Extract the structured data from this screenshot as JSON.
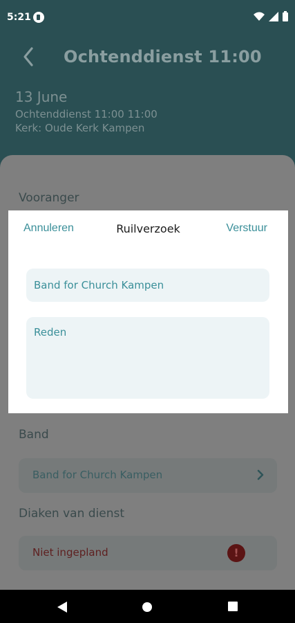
{
  "status_bar": {
    "time": "5:21"
  },
  "header": {
    "title": "Ochtenddienst 11:00",
    "date": "13 June",
    "service_line": "Ochtenddienst 11:00 11:00",
    "church_line": "Kerk: Oude Kerk Kampen"
  },
  "sheet": {
    "voorganger_label": "Vooranger",
    "band_label": "Band",
    "band_value": "Band for Church Kampen",
    "diaken_label": "Diaken van dienst",
    "diaken_value": "Niet ingepland",
    "alert_glyph": "!"
  },
  "dialog": {
    "cancel_label": "Annuleren",
    "title": "Ruilverzoek",
    "send_label": "Verstuur",
    "band_field_value": "Band for Church Kampen",
    "reason_placeholder": "Reden"
  },
  "colors": {
    "header_bg": "#2a4f53",
    "accent": "#3a8f99",
    "dialog_bg": "#ffffff",
    "alert": "#5b1414"
  }
}
